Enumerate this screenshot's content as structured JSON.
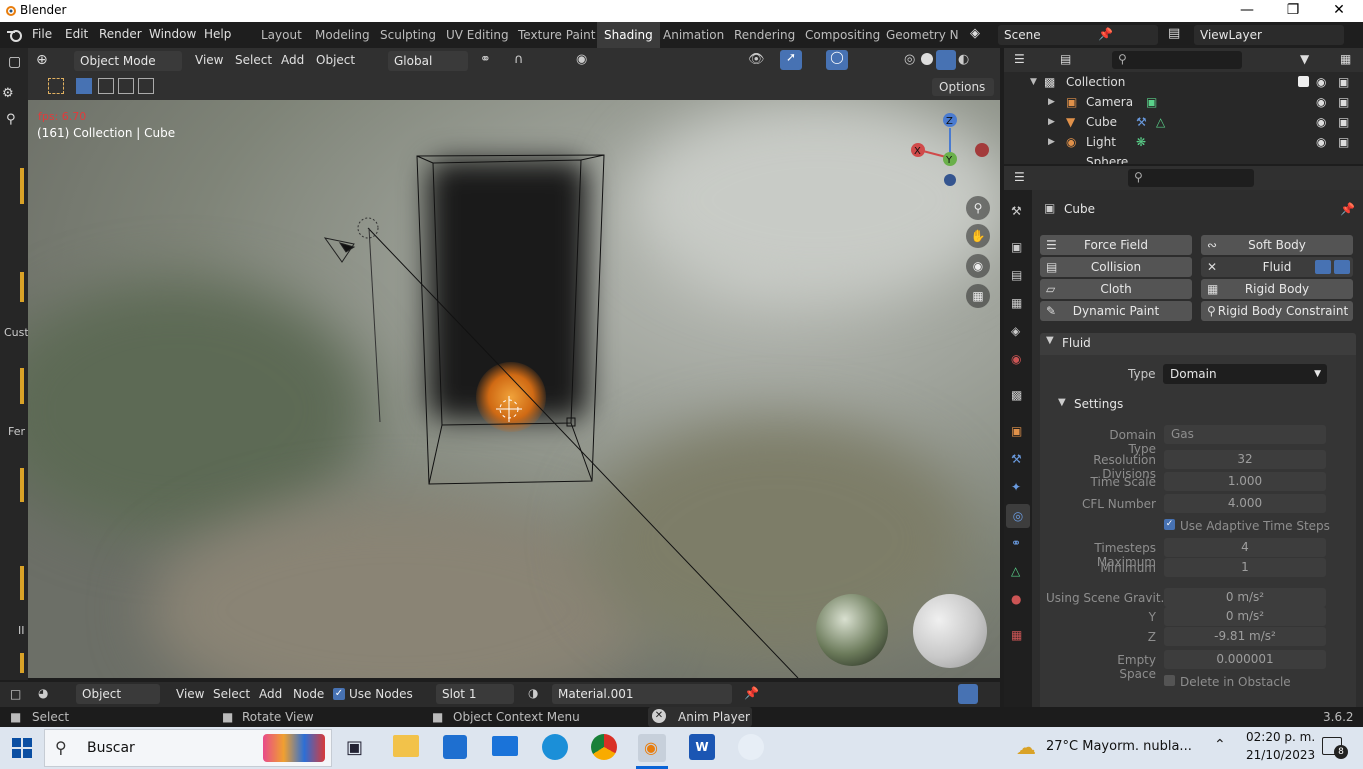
{
  "window": {
    "title": "Blender"
  },
  "menu": {
    "file": "File",
    "edit": "Edit",
    "render": "Render",
    "window": "Window",
    "help": "Help"
  },
  "workspaces": [
    "Layout",
    "Modeling",
    "Sculpting",
    "UV Editing",
    "Texture Paint",
    "Shading",
    "Animation",
    "Rendering",
    "Compositing",
    "Geometry Noc"
  ],
  "scene": {
    "name": "Scene",
    "viewlayer": "ViewLayer"
  },
  "viewport": {
    "mode": "Object Mode",
    "menus": [
      "View",
      "Select",
      "Add",
      "Object"
    ],
    "orientation": "Global",
    "options": "Options",
    "fps": "fps: 6.70",
    "info": "(161) Collection | Cube"
  },
  "outliner": {
    "collection": "Collection",
    "items": [
      "Camera",
      "Cube",
      "Light",
      "Sphere"
    ]
  },
  "properties": {
    "object": "Cube",
    "physics_buttons": [
      [
        "Force Field",
        "Soft Body"
      ],
      [
        "Collision",
        "Fluid"
      ],
      [
        "Cloth",
        "Rigid Body"
      ],
      [
        "Dynamic Paint",
        "Rigid Body Constraint"
      ]
    ],
    "fluid_header": "Fluid",
    "type_label": "Type",
    "type_value": "Domain",
    "settings_header": "Settings",
    "rows": [
      {
        "label": "Domain Type",
        "value": "Gas"
      },
      {
        "label": "Resolution Divisions",
        "value": "32"
      },
      {
        "label": "Time Scale",
        "value": "1.000"
      },
      {
        "label": "CFL Number",
        "value": "4.000"
      },
      {
        "label": "Timesteps Maximum",
        "value": "4"
      },
      {
        "label": "Minimum",
        "value": "1"
      },
      {
        "label": "Using Scene Gravit...",
        "value": "0 m/s²"
      },
      {
        "label": "Y",
        "value": "0 m/s²"
      },
      {
        "label": "Z",
        "value": "-9.81 m/s²"
      },
      {
        "label": "Empty Space",
        "value": "0.000001"
      }
    ],
    "adaptive": "Use Adaptive Time Steps",
    "delete_obstacle": "Delete in Obstacle"
  },
  "shader_bar": {
    "editor": "Object",
    "menus": [
      "View",
      "Select",
      "Add",
      "Node"
    ],
    "use_nodes": "Use Nodes",
    "slot": "Slot 1",
    "material": "Material.001"
  },
  "statusbar": {
    "select": "Select",
    "rotate": "Rotate View",
    "context": "Object Context Menu",
    "anim": "Anim Player",
    "version": "3.6.2"
  },
  "sidebar_text": [
    "Cust",
    "Fer",
    "II"
  ],
  "taskbar": {
    "search": "Buscar",
    "weather": "27°C  Mayorm. nubla...",
    "time": "02:20 p. m.",
    "date": "21/10/2023",
    "notif": "8"
  },
  "colors": {
    "accent": "#4772b3",
    "header": "#303030",
    "panel": "#2d2d2d"
  }
}
